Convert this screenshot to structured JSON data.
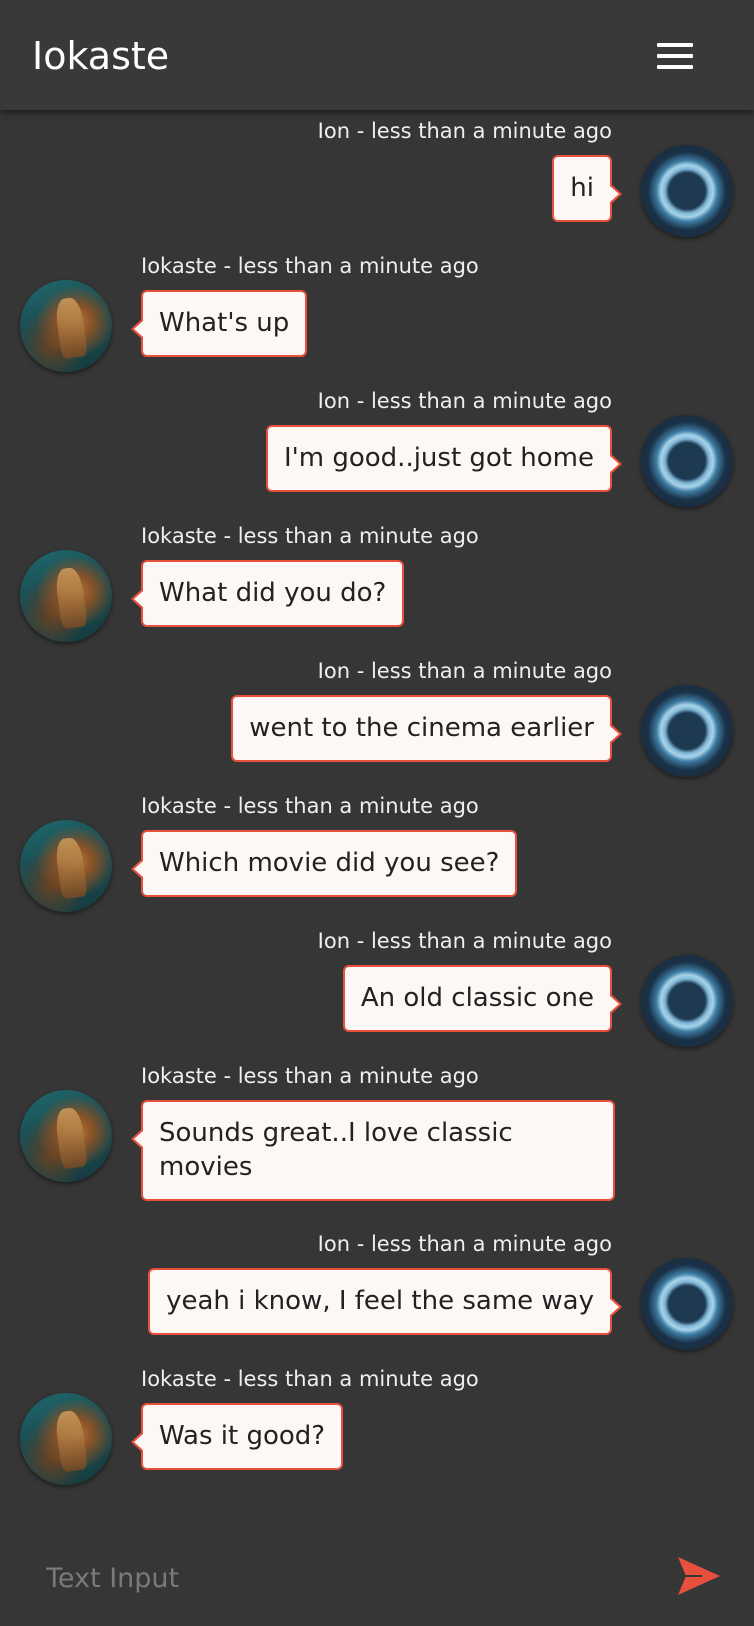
{
  "header": {
    "title": "Iokaste"
  },
  "messages": [
    {
      "direction": "out",
      "meta": "Ion - less than a minute ago",
      "text": "hi"
    },
    {
      "direction": "in",
      "meta": "Iokaste - less than a minute ago",
      "text": "What's up"
    },
    {
      "direction": "out",
      "meta": "Ion - less than a minute ago",
      "text": "I'm good..just got home"
    },
    {
      "direction": "in",
      "meta": "Iokaste - less than a minute ago",
      "text": "What did you do?"
    },
    {
      "direction": "out",
      "meta": "Ion - less than a minute ago",
      "text": "went to the cinema earlier"
    },
    {
      "direction": "in",
      "meta": "Iokaste - less than a minute ago",
      "text": "Which movie did you see?"
    },
    {
      "direction": "out",
      "meta": "Ion - less than a minute ago",
      "text": "An old classic one"
    },
    {
      "direction": "in",
      "meta": "Iokaste - less than a minute ago",
      "text": "Sounds great..I love classic movies"
    },
    {
      "direction": "out",
      "meta": "Ion - less than a minute ago",
      "text": "yeah i know, I feel the same way"
    },
    {
      "direction": "in",
      "meta": "Iokaste - less than a minute ago",
      "text": "Was it good?"
    }
  ],
  "composer": {
    "placeholder": "Text Input"
  },
  "icons": {
    "menu": "hamburger-menu-icon",
    "send": "send-icon"
  },
  "colors": {
    "accent": "#e8503e",
    "background": "#363636",
    "header": "#393939",
    "bubble": "#fdf8f6"
  }
}
